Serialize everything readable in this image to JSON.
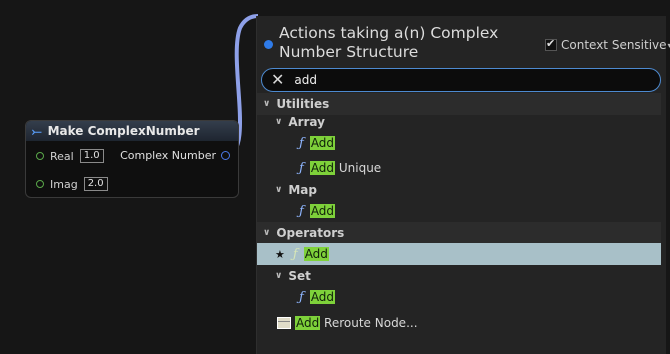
{
  "node": {
    "title": "Make ComplexNumber",
    "title_icon": "make-struct-icon",
    "pins": [
      {
        "label": "Real",
        "value": "1.0"
      },
      {
        "label": "Imag",
        "value": "2.0"
      }
    ],
    "output_label": "Complex Number"
  },
  "panel": {
    "title": "Actions taking a(n) Complex Number Structure",
    "context_label": "Context Sensitive",
    "context_checked": true,
    "search_value": "add"
  },
  "tree": {
    "utilities": "Utilities",
    "array": "Array",
    "array_items": [
      {
        "hl": "Add",
        "rest": ""
      },
      {
        "hl": "Add",
        "rest": " Unique"
      }
    ],
    "map": "Map",
    "map_item": {
      "hl": "Add",
      "rest": ""
    },
    "operators": "Operators",
    "operators_item": {
      "hl": "Add",
      "rest": ""
    },
    "set": "Set",
    "set_item": {
      "hl": "Add",
      "rest": ""
    },
    "reroute": {
      "hl": "Add",
      "rest": " Reroute Node..."
    }
  },
  "colors": {
    "highlight": "#7ed13a",
    "selection": "#a8c0c8",
    "wire": "#8ea0e8",
    "search_border": "#4d8ad0"
  }
}
